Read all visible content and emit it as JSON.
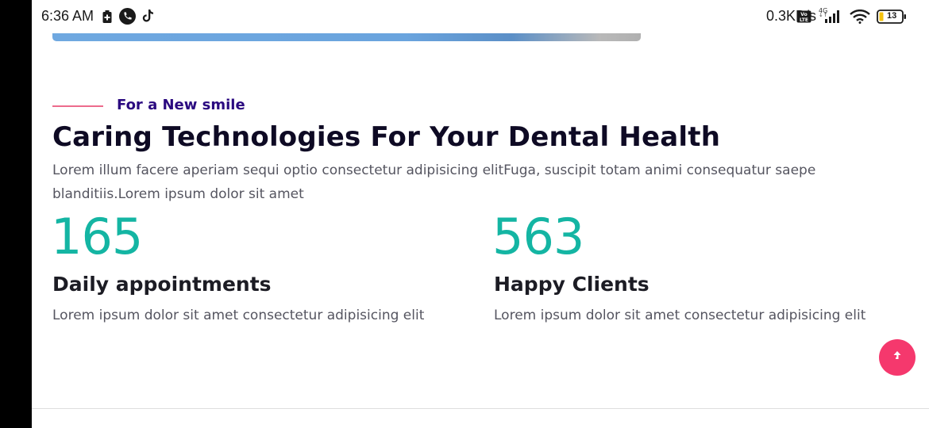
{
  "status_bar": {
    "time": "6:36 AM",
    "net_speed": "0.3KB/s",
    "battery_level": "13",
    "signal_label": "4G",
    "icons": [
      "battery-saver-icon",
      "phone-icon",
      "tiktok-icon",
      "volte-icon",
      "signal-icon",
      "wifi-icon",
      "battery-icon"
    ]
  },
  "section": {
    "eyebrow": "For a New smile",
    "title": "Caring Technologies For Your Dental Health",
    "intro": "Lorem illum facere aperiam sequi optio consectetur adipisicing elitFuga, suscipit totam animi consequatur saepe blanditiis.Lorem ipsum dolor sit amet"
  },
  "stats": [
    {
      "number": "165",
      "title": "Daily appointments",
      "description": "Lorem ipsum dolor sit amet consectetur adipisicing elit"
    },
    {
      "number": "563",
      "title": "Happy Clients",
      "description": "Lorem ipsum dolor sit amet consectetur adipisicing elit"
    }
  ],
  "colors": {
    "accent_teal": "#14b5a3",
    "eyebrow_purple": "#2b0a80",
    "eyebrow_line": "#ec6b8c",
    "scroll_button": "#f5386d"
  },
  "scroll_top_icon": "arrow-up-icon"
}
